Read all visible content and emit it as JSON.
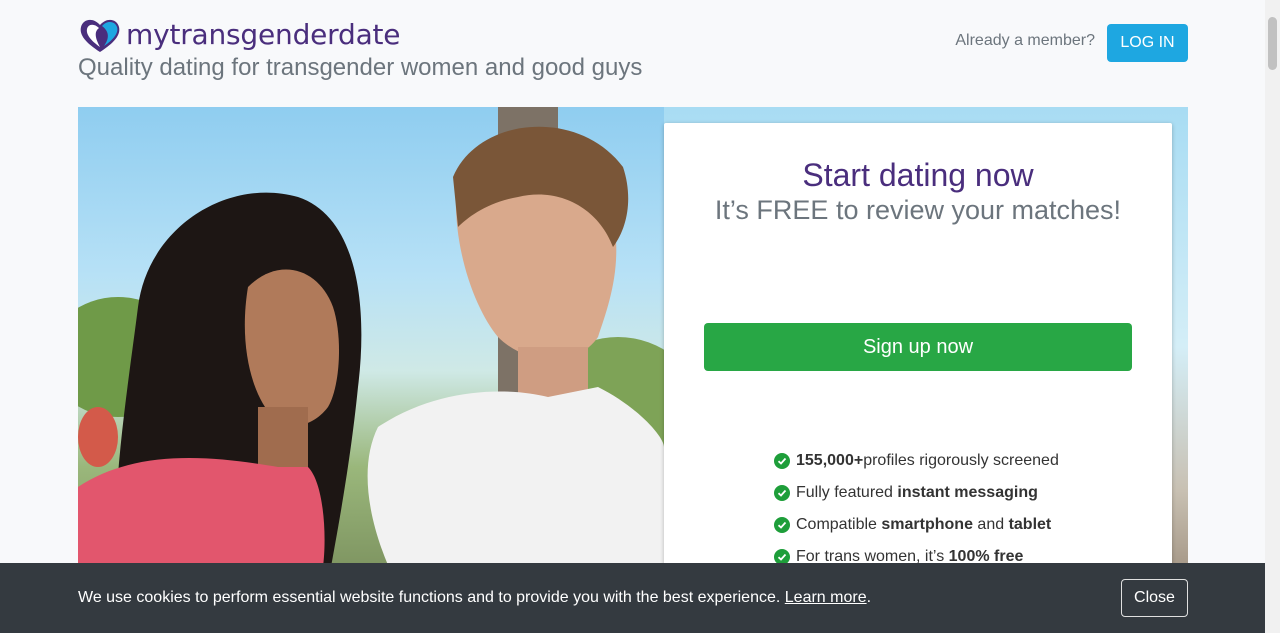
{
  "header": {
    "logo_text": "mytransgenderdate",
    "tagline": "Quality dating for transgender women and good guys",
    "member_text": "Already a member?",
    "login_label": "LOG IN"
  },
  "card": {
    "title": "Start dating now",
    "subtitle": "It’s FREE to review your matches!",
    "signup_label": "Sign up now",
    "features": [
      {
        "bold1": "155,000+",
        "text1": " profiles rigorously screened",
        "bold2": "",
        "text2": "",
        "bold3": ""
      },
      {
        "bold1": "",
        "text1": "Fully featured ",
        "bold2": "instant messaging",
        "text2": "",
        "bold3": ""
      },
      {
        "bold1": "",
        "text1": "Compatible ",
        "bold2": "smartphone",
        "text2": " and ",
        "bold3": "tablet"
      },
      {
        "bold1": "",
        "text1": "For trans women, it’s ",
        "bold2": "100% free",
        "text2": "",
        "bold3": ""
      }
    ]
  },
  "cookie": {
    "text": "We use cookies to perform essential website functions and to provide you with the best experience.",
    "link": "Learn more",
    "period": ".",
    "close_label": "Close"
  },
  "icons": {
    "logo": "heart-logo-icon",
    "check": "check-circle-icon"
  },
  "colors": {
    "brand_purple": "#4a2e7d",
    "login_blue": "#1ea7e1",
    "signup_green": "#28a745",
    "check_green": "#1e9e3a",
    "cookie_bg": "#343a40"
  }
}
